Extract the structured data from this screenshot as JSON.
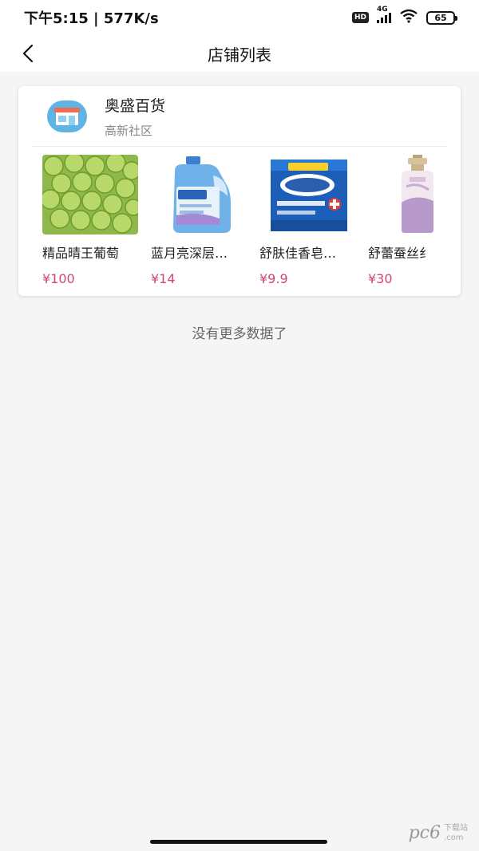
{
  "status_bar": {
    "time_speed": "下午5:15 | 577K/s",
    "hd": "HD",
    "network": "4G",
    "battery": "65"
  },
  "header": {
    "title": "店铺列表",
    "back_icon": "chevron-left-icon"
  },
  "store": {
    "name": "奥盛百货",
    "community": "高新社区",
    "icon": "store-icon",
    "icon_color": "#5fb4e6",
    "products": [
      {
        "name": "精品晴王葡萄",
        "price": "¥100"
      },
      {
        "name": "蓝月亮深层…",
        "price": "¥14"
      },
      {
        "name": "舒肤佳香皂…",
        "price": "¥9.9"
      },
      {
        "name": "舒蕾蚕丝纟",
        "price": "¥30"
      }
    ]
  },
  "footer_text": "没有更多数据了",
  "watermark": {
    "logo": "pc6",
    "sub": "下载站",
    "url": ".com"
  },
  "colors": {
    "price": "#d2476c",
    "background": "#f5f5f6"
  }
}
